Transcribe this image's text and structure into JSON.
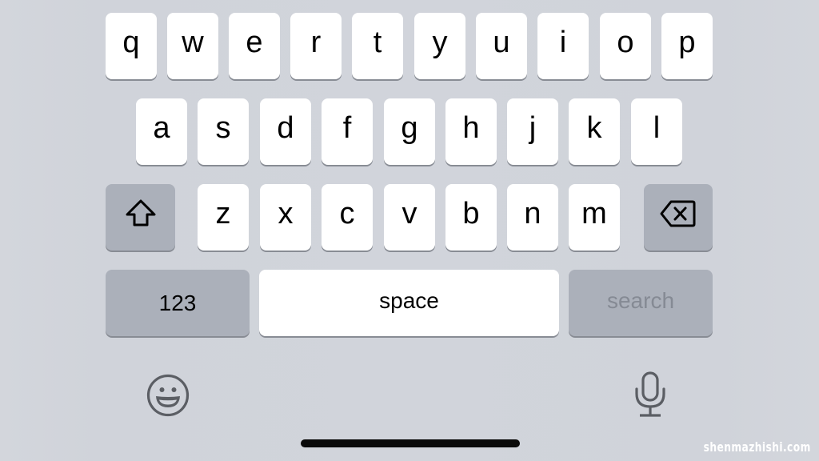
{
  "keyboard": {
    "row1": [
      "q",
      "w",
      "e",
      "r",
      "t",
      "y",
      "u",
      "i",
      "o",
      "p"
    ],
    "row2": [
      "a",
      "s",
      "d",
      "f",
      "g",
      "h",
      "j",
      "k",
      "l"
    ],
    "row3": [
      "z",
      "x",
      "c",
      "v",
      "b",
      "n",
      "m"
    ],
    "shift_icon": "shift-arrow-icon",
    "backspace_icon": "backspace-icon",
    "numbers_label": "123",
    "space_label": "space",
    "search_label": "search",
    "emoji_icon": "emoji-smile-icon",
    "dictation_icon": "microphone-icon"
  },
  "colors": {
    "background": "#d1d4db",
    "letter_key": "#ffffff",
    "function_key": "#abb0ba",
    "search_disabled_text": "#858a94"
  },
  "watermark": "shenmazhishi.com"
}
